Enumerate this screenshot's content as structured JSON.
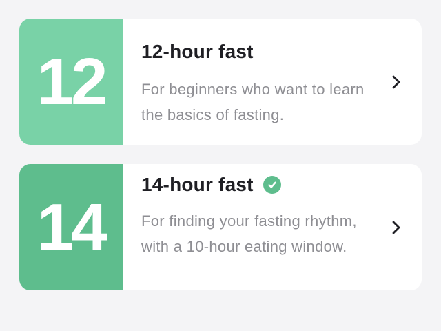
{
  "plans": [
    {
      "number": "12",
      "title": "12-hour fast",
      "description": "For beginners who want to learn the basics of fasting.",
      "selected": false,
      "badge_color": "#79d2a7"
    },
    {
      "number": "14",
      "title": "14-hour fast",
      "description": "For finding your fasting rhythm, with a 10-hour eating window.",
      "selected": true,
      "badge_color": "#5ebd8d"
    }
  ],
  "icons": {
    "selected": "check-circle-icon",
    "open": "chevron-right-icon"
  }
}
